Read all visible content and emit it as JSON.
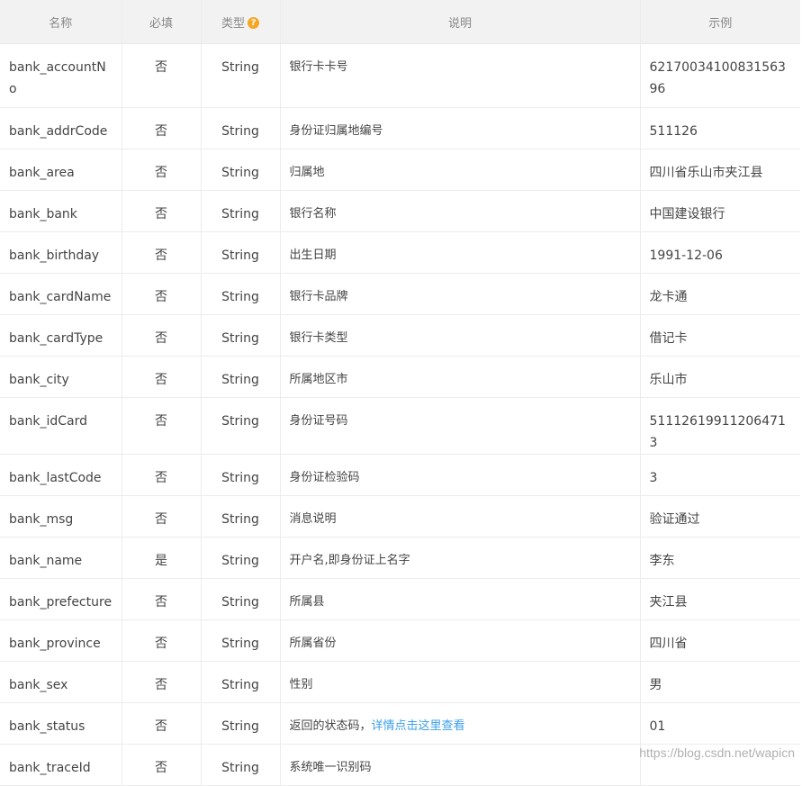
{
  "headers": {
    "name": "名称",
    "required": "必填",
    "type": "类型",
    "type_help_icon": "?",
    "description": "说明",
    "example": "示例"
  },
  "rows": [
    {
      "name": "bank_accountNo",
      "required": "否",
      "type": "String",
      "description": "银行卡卡号",
      "example": "6217003410083156396"
    },
    {
      "name": "bank_addrCode",
      "required": "否",
      "type": "String",
      "description": "身份证归属地编号",
      "example": "511126"
    },
    {
      "name": "bank_area",
      "required": "否",
      "type": "String",
      "description": "归属地",
      "example": "四川省乐山市夹江县"
    },
    {
      "name": "bank_bank",
      "required": "否",
      "type": "String",
      "description": "银行名称",
      "example": "中国建设银行"
    },
    {
      "name": "bank_birthday",
      "required": "否",
      "type": "String",
      "description": "出生日期",
      "example": "1991-12-06"
    },
    {
      "name": "bank_cardName",
      "required": "否",
      "type": "String",
      "description": "银行卡品牌",
      "example": "龙卡通"
    },
    {
      "name": "bank_cardType",
      "required": "否",
      "type": "String",
      "description": "银行卡类型",
      "example": "借记卡"
    },
    {
      "name": "bank_city",
      "required": "否",
      "type": "String",
      "description": "所属地区市",
      "example": "乐山市"
    },
    {
      "name": "bank_idCard",
      "required": "否",
      "type": "String",
      "description": "身份证号码",
      "example": "511126199112064713"
    },
    {
      "name": "bank_lastCode",
      "required": "否",
      "type": "String",
      "description": "身份证检验码",
      "example": "3"
    },
    {
      "name": "bank_msg",
      "required": "否",
      "type": "String",
      "description": "消息说明",
      "example": "验证通过"
    },
    {
      "name": "bank_name",
      "required": "是",
      "type": "String",
      "description": "开户名,即身份证上名字",
      "example": "李东"
    },
    {
      "name": "bank_prefecture",
      "required": "否",
      "type": "String",
      "description": "所属县",
      "example": "夹江县"
    },
    {
      "name": "bank_province",
      "required": "否",
      "type": "String",
      "description": "所属省份",
      "example": "四川省"
    },
    {
      "name": "bank_sex",
      "required": "否",
      "type": "String",
      "description": "性别",
      "example": "男"
    },
    {
      "name": "bank_status",
      "required": "否",
      "type": "String",
      "description": "返回的状态码，",
      "description_link": "详情点击这里查看",
      "example": "01"
    },
    {
      "name": "bank_traceId",
      "required": "否",
      "type": "String",
      "description": "系统唯一识别码",
      "example": ""
    }
  ],
  "watermark": "https://blog.csdn.net/wapicn"
}
